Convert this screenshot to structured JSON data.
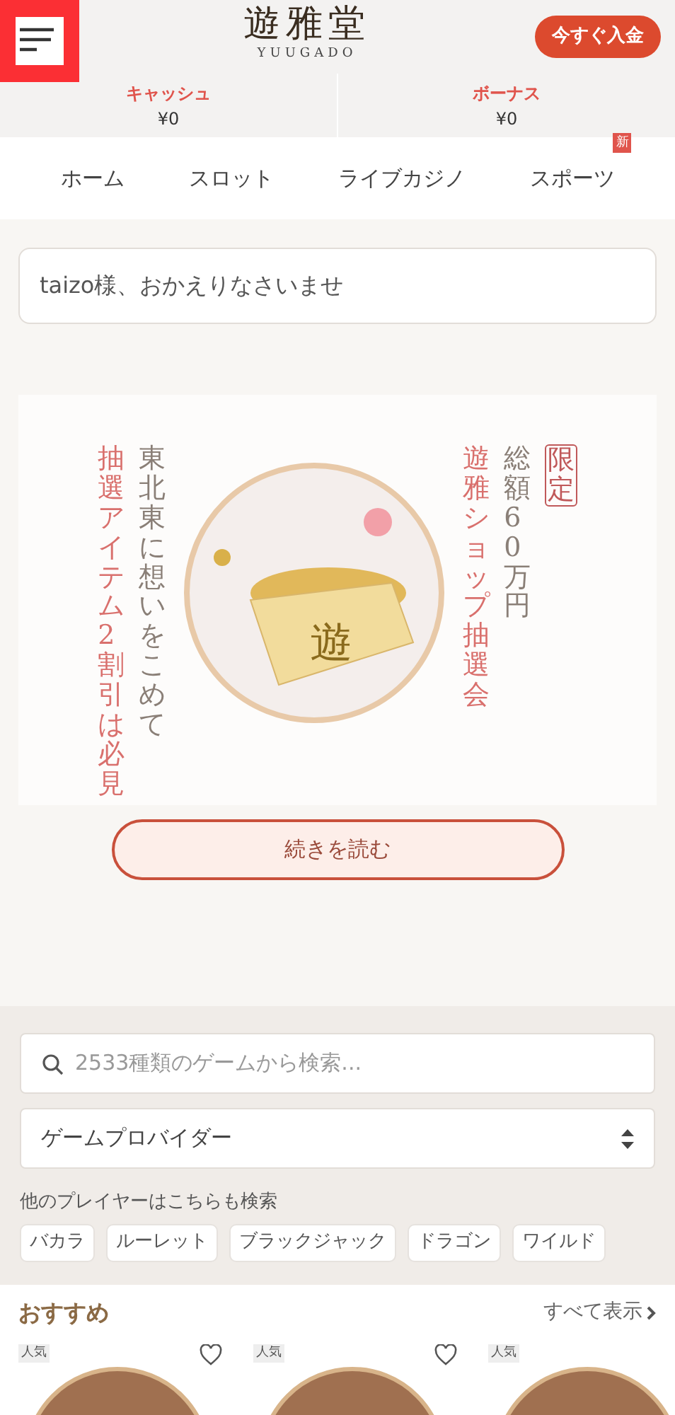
{
  "header": {
    "logo": "遊雅堂",
    "logo_sub": "YUUGADO",
    "deposit_button": "今すぐ入金"
  },
  "balances": [
    {
      "label": "キャッシュ",
      "value": "¥0"
    },
    {
      "label": "ボーナス",
      "value": "¥0"
    }
  ],
  "nav": [
    {
      "label": "ホーム"
    },
    {
      "label": "スロット"
    },
    {
      "label": "ライブカジノ"
    },
    {
      "label": "スポーツ",
      "badge": "新"
    }
  ],
  "welcome": "taizo様、おかえりなさいませ",
  "banner": {
    "left_columns": [
      {
        "text": "抽選アイテム2割引は必見",
        "color": "#d9706d"
      },
      {
        "text": "東北東に想いをこめて",
        "color": "#8a7f77"
      }
    ],
    "right_columns": [
      {
        "text": "遊雅ショップ抽選会",
        "color": "#d9706d"
      },
      {
        "text": "総額60万円",
        "color": "#8a7f77"
      }
    ],
    "tag": "限定",
    "box_label": "遊"
  },
  "read_more": "続きを読む",
  "search": {
    "placeholder": "2533種類のゲームから検索...",
    "provider": "ゲームプロバイダー",
    "suggest_label": "他のプレイヤーはこちらも検索",
    "chips": [
      "バカラ",
      "ルーレット",
      "ブラックジャック",
      "ドラゴン",
      "ワイルド"
    ]
  },
  "recommended": {
    "title": "おすすめ",
    "view_all": "すべて表示",
    "games": [
      {
        "badge": "人気"
      },
      {
        "badge": "人気"
      },
      {
        "badge": "人気"
      }
    ]
  }
}
